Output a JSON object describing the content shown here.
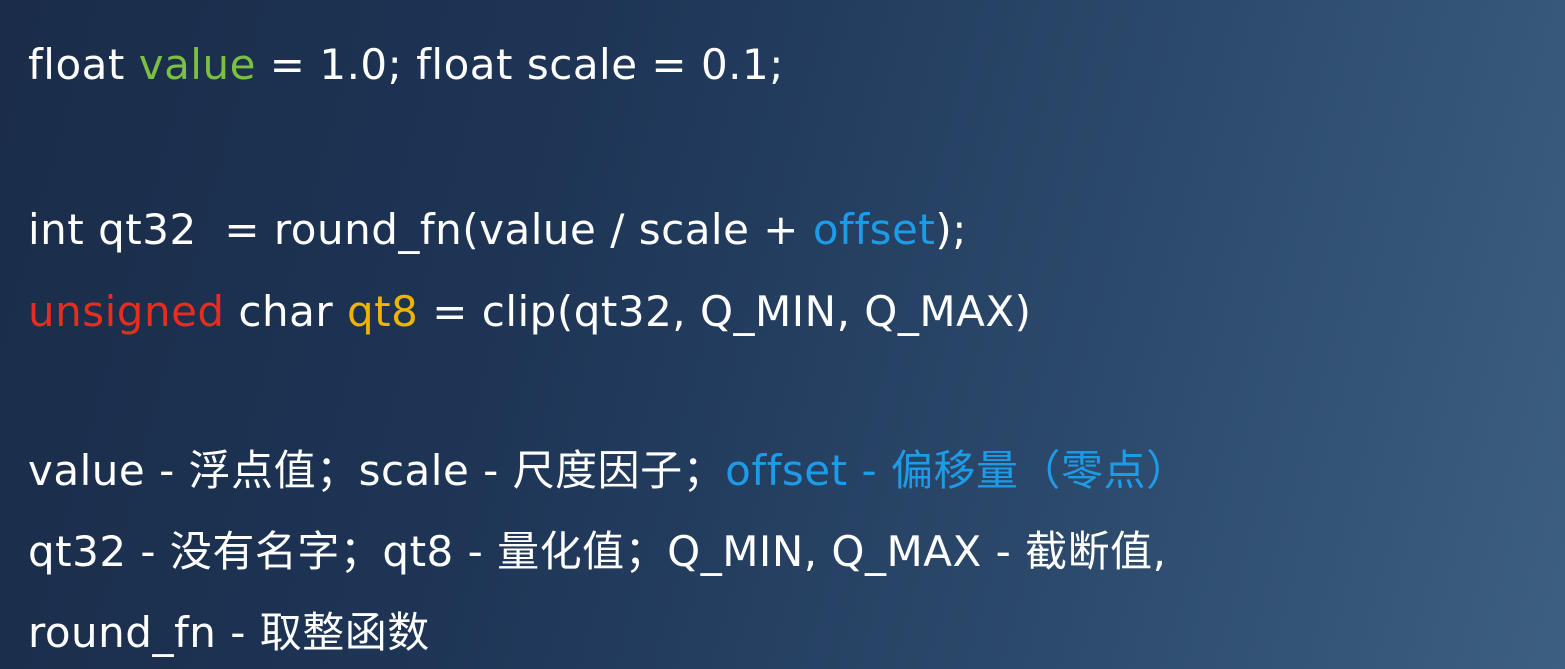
{
  "colors": {
    "variable_green": "#7bc043",
    "offset_blue": "#1e9be8",
    "keyword_red": "#e62d1e",
    "qt8_orange": "#f0b400",
    "text_white": "#ffffff",
    "background": "#1e3556"
  },
  "code": {
    "line1": {
      "p1": "float ",
      "p2": "value",
      "p3": " = 1.0; float scale = 0.1;"
    },
    "line2": {
      "p1": "int qt32  = round_fn(value / scale + ",
      "p2": "offset",
      "p3": ");"
    },
    "line3": {
      "p1": "unsigned",
      "p2": " char ",
      "p3": "qt8",
      "p4": " = clip(qt32, Q_MIN, Q_MAX)"
    }
  },
  "notes": {
    "line1": {
      "p1": "value - 浮点值；scale - 尺度因子；",
      "p2": "offset - 偏移量（零点）"
    },
    "line2": "qt32 - 没有名字；qt8 - 量化值；Q_MIN, Q_MAX - 截断值,",
    "line3": "round_fn - 取整函数"
  }
}
